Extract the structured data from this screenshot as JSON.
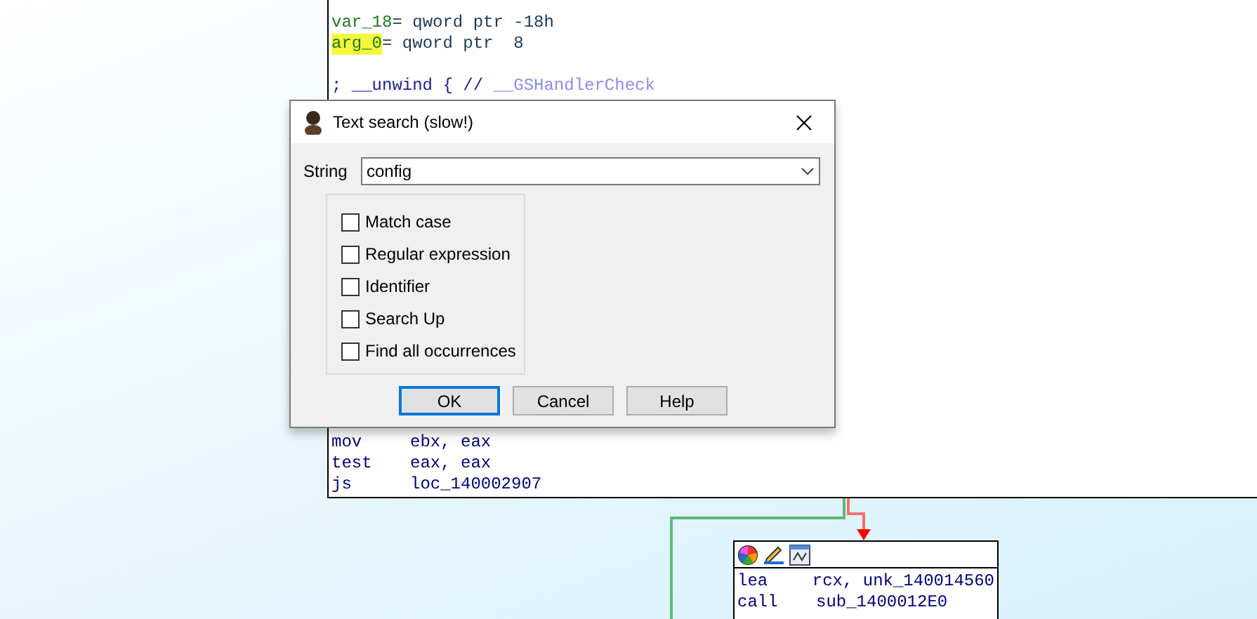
{
  "graph": {
    "node_main": {
      "top_lines": [
        {
          "kind": "var",
          "name": "var_18",
          "rest": "= qword ptr -18h",
          "highlighted": false
        },
        {
          "kind": "var",
          "name": "arg_0",
          "rest": "= qword ptr  8",
          "highlighted": true
        },
        {
          "kind": "blank"
        },
        {
          "kind": "comment",
          "text": "; __unwind { // ",
          "link": "__GSHandlerCheck"
        }
      ],
      "bottom_lines": [
        {
          "kind": "insn",
          "mnemonic": "mov",
          "operands": "ebx, eax"
        },
        {
          "kind": "insn",
          "mnemonic": "test",
          "operands": "eax, eax"
        },
        {
          "kind": "insn",
          "mnemonic": "js",
          "operands": "loc_140002907"
        }
      ]
    },
    "node_next": {
      "lines": [
        {
          "kind": "insn",
          "mnemonic": "lea",
          "operands": "rcx, unk_140014560"
        },
        {
          "kind": "insn",
          "mnemonic": "call",
          "operands": "sub_1400012E0"
        }
      ]
    }
  },
  "dialog": {
    "title": "Text search (slow!)",
    "string_label": "String",
    "string_value": "config",
    "options": [
      {
        "label": "Match case",
        "checked": false
      },
      {
        "label": "Regular expression",
        "checked": false
      },
      {
        "label": "Identifier",
        "checked": false
      },
      {
        "label": "Search Up",
        "checked": false
      },
      {
        "label": "Find all occurrences",
        "checked": false
      }
    ],
    "buttons": [
      {
        "label": "OK",
        "default": true
      },
      {
        "label": "Cancel",
        "default": false
      },
      {
        "label": "Help",
        "default": false
      }
    ]
  }
}
